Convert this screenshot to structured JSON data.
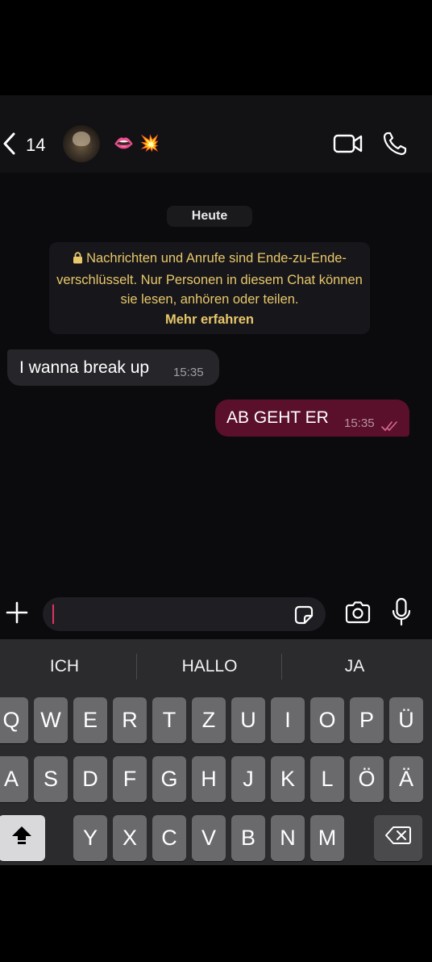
{
  "header": {
    "back_count": "14",
    "name_emojis": [
      "👄",
      "💥"
    ],
    "icons": {
      "back": "chevron-left-icon",
      "video": "video-camera-icon",
      "call": "phone-icon"
    }
  },
  "chat": {
    "date_label": "Heute",
    "encryption_notice": "Nachrichten und Anrufe sind Ende-zu-Ende-verschlüsselt. Nur Personen in diesem Chat können sie lesen, anhören oder teilen.",
    "encryption_link": "Mehr erfahren",
    "messages": [
      {
        "direction": "incoming",
        "text": "I wanna break up",
        "time": "15:35"
      },
      {
        "direction": "outgoing",
        "text": "AB GEHT ER",
        "time": "15:35",
        "status": "read"
      }
    ]
  },
  "composer": {
    "value": "",
    "icons": [
      "plus-icon",
      "sticker-icon",
      "camera-icon",
      "microphone-icon"
    ]
  },
  "keyboard": {
    "suggestions": [
      "ICH",
      "HALLO",
      "JA"
    ],
    "rows": [
      [
        "Q",
        "W",
        "E",
        "R",
        "T",
        "Z",
        "U",
        "I",
        "O",
        "P",
        "Ü"
      ],
      [
        "A",
        "S",
        "D",
        "F",
        "G",
        "H",
        "J",
        "K",
        "L",
        "Ö",
        "Ä"
      ],
      [
        "Y",
        "X",
        "C",
        "V",
        "B",
        "N",
        "M"
      ]
    ]
  },
  "colors": {
    "background": "#0b0a0c",
    "outgoing_bubble": "#5a0f2a",
    "incoming_bubble": "#26252a",
    "encryption_text": "#e8c86b",
    "caret": "#e0335f"
  }
}
